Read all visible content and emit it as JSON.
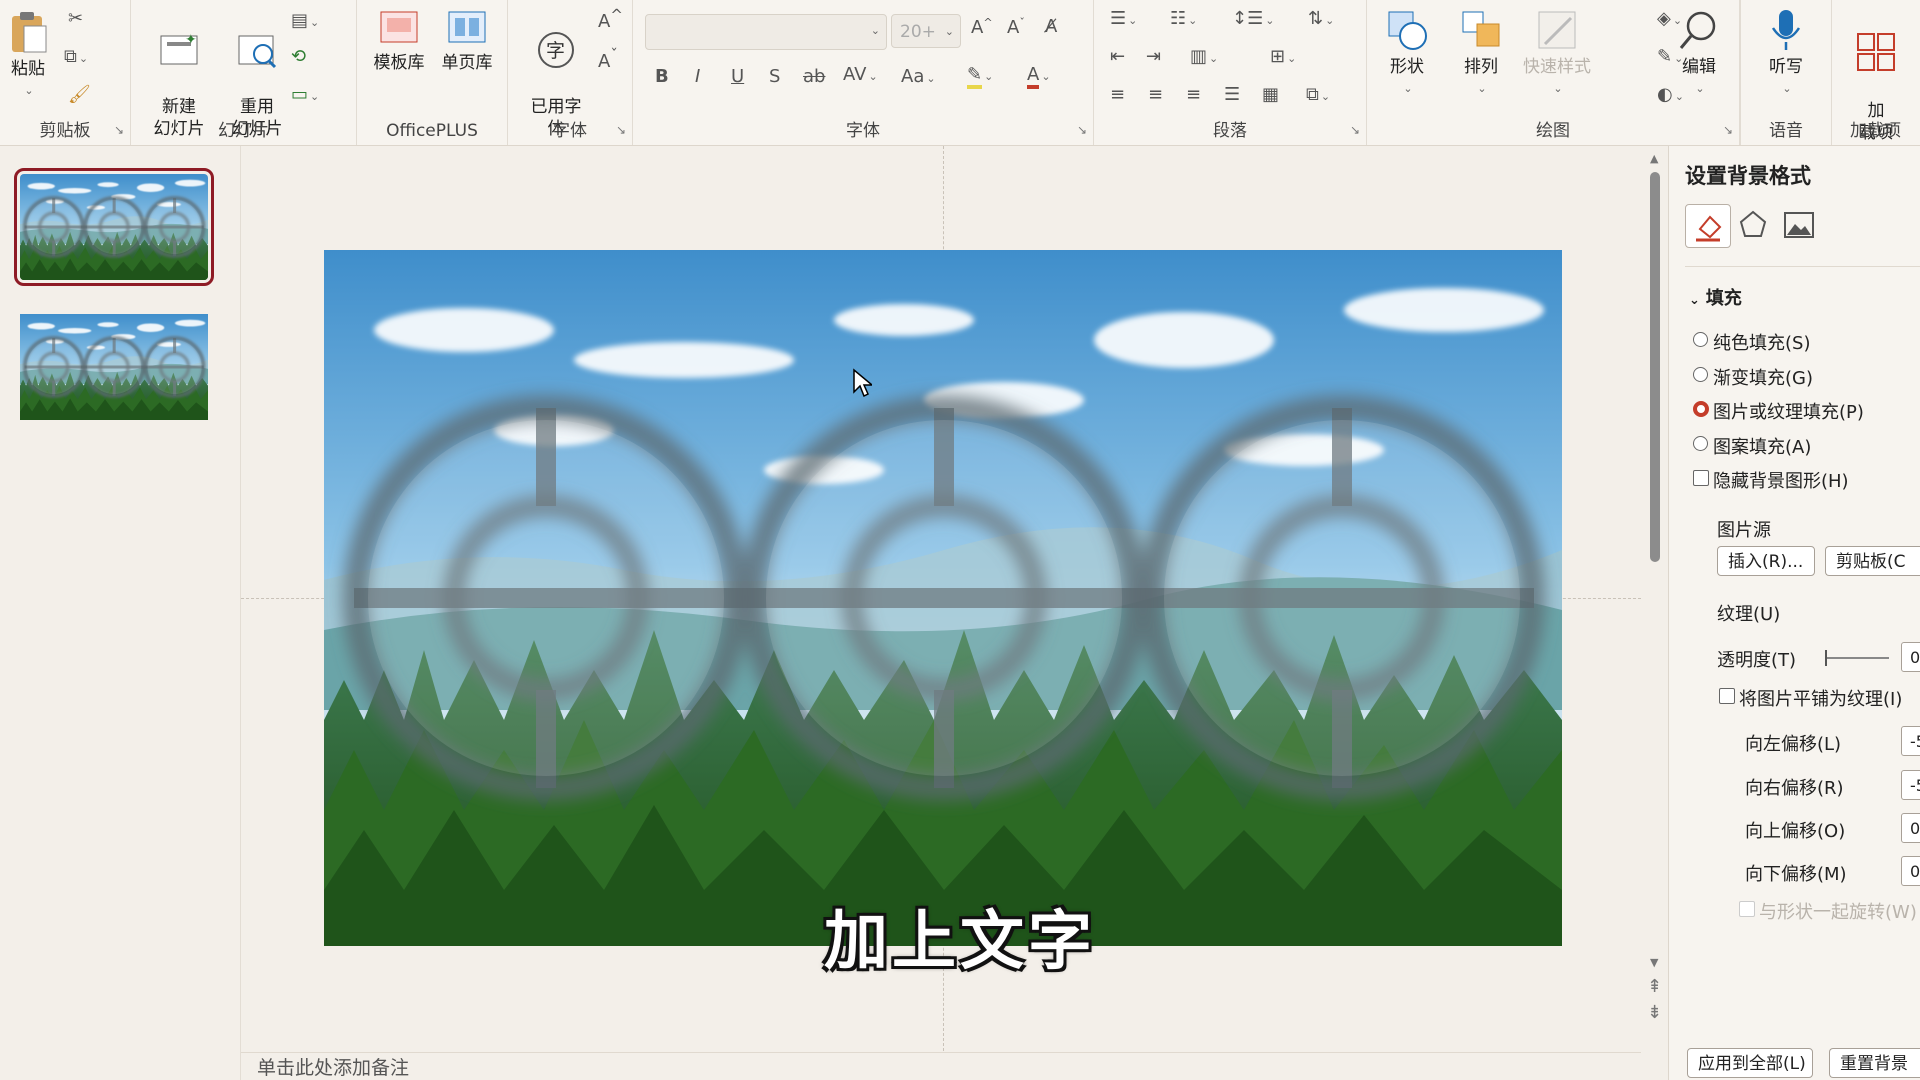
{
  "ribbon": {
    "clipboard": {
      "group": "剪贴板",
      "paste": "粘贴"
    },
    "slides": {
      "group": "幻灯片",
      "new_slide": "新建\n幻灯片",
      "reuse_slide": "重用\n幻灯片"
    },
    "officeplus": {
      "group": "OfficePLUS",
      "template_lib": "模板库",
      "single_page_lib": "单页库"
    },
    "used_fonts": {
      "group": "字体",
      "label": "已用字\n体"
    },
    "font": {
      "group": "字体",
      "size": "20+",
      "bold": "B",
      "italic": "I",
      "underline": "U",
      "shadow": "S",
      "strike": "ab",
      "spacing": "AV",
      "case": "Aa",
      "grow": "A^",
      "shrink": "Aˇ"
    },
    "paragraph": {
      "group": "段落"
    },
    "drawing": {
      "group": "绘图",
      "shapes": "形状",
      "arrange": "排列",
      "quick_styles": "快速样式"
    },
    "editing": {
      "label": "编辑"
    },
    "voice": {
      "group": "语音",
      "dictate": "听写"
    },
    "addins": {
      "group": "加载项",
      "label": "加\n载项"
    }
  },
  "notes_placeholder": "单击此处添加备注",
  "subtitle": "加上文字",
  "format_pane": {
    "title": "设置背景格式",
    "fill_section": "填充",
    "options": [
      {
        "label": "纯色填充(S)",
        "selected": false
      },
      {
        "label": "渐变填充(G)",
        "selected": false
      },
      {
        "label": "图片或纹理填充(P)",
        "selected": true
      },
      {
        "label": "图案填充(A)",
        "selected": false
      }
    ],
    "hide_bg_graphics": "隐藏背景图形(H)",
    "picture_source": "图片源",
    "insert_btn": "插入(R)...",
    "clipboard_btn": "剪贴板(C",
    "texture": "纹理(U)",
    "transparency": "透明度(T)",
    "transparency_value": "0",
    "tile_picture": "将图片平铺为纹理(I)",
    "offset_left": "向左偏移(L)",
    "offset_left_value": "-5",
    "offset_right": "向右偏移(R)",
    "offset_right_value": "-5",
    "offset_top": "向上偏移(O)",
    "offset_top_value": "0",
    "offset_bottom": "向下偏移(M)",
    "offset_bottom_value": "0",
    "rotate_with_shape": "与形状一起旋转(W)",
    "apply_all": "应用到全部(L)",
    "reset_bg": "重置背景"
  },
  "colors": {
    "accent": "#c43d2a",
    "thumb_border": "#8e1b25",
    "sky": "#4f9bd1",
    "forest": "#2f6b2a"
  }
}
